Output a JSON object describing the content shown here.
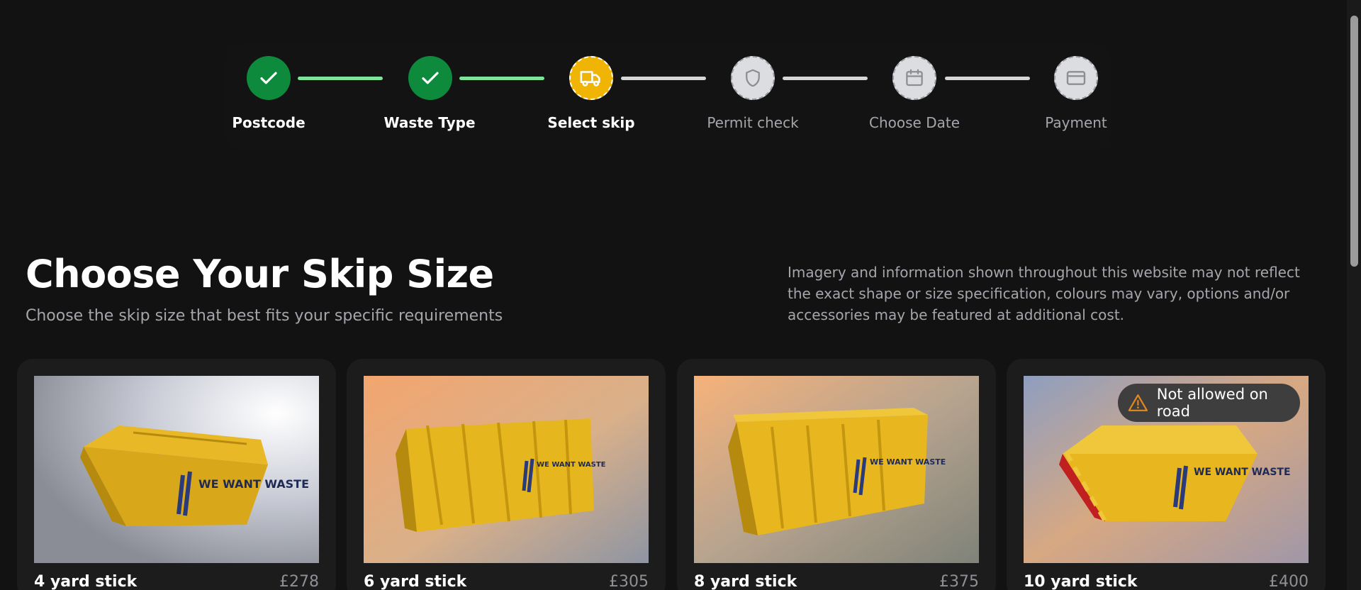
{
  "stepper": {
    "steps": [
      {
        "label": "Postcode",
        "status": "done",
        "icon": "check-icon"
      },
      {
        "label": "Waste Type",
        "status": "done",
        "icon": "check-icon"
      },
      {
        "label": "Select skip",
        "status": "current",
        "icon": "truck-icon"
      },
      {
        "label": "Permit check",
        "status": "pending",
        "icon": "shield-icon"
      },
      {
        "label": "Choose Date",
        "status": "pending",
        "icon": "calendar-icon"
      },
      {
        "label": "Payment",
        "status": "pending",
        "icon": "credit-card-icon"
      }
    ]
  },
  "header": {
    "title": "Choose Your Skip Size",
    "subtitle": "Choose the skip size that best fits your specific requirements",
    "disclaimer": "Imagery and information shown throughout this website may not reflect the exact shape or size specification, colours may vary, options and/or accessories may be featured at additional cost."
  },
  "cards": [
    {
      "name": "4 yard stick",
      "price": "£278",
      "image_logo": "WE WANT WASTE"
    },
    {
      "name": "6 yard stick",
      "price": "£305",
      "image_logo": "WE WANT WASTE"
    },
    {
      "name": "8 yard stick",
      "price": "£375",
      "image_logo": "WE WANT WASTE"
    },
    {
      "name": "10 yard stick",
      "price": "£400",
      "image_logo": "WE WANT WASTE",
      "badge": "Not allowed on road",
      "badge_icon": "warning-icon"
    }
  ],
  "colors": {
    "background": "#121212",
    "card": "#1c1c1c",
    "done": "#0e8a3c",
    "current": "#efb404",
    "progress_line": "#7fe39a",
    "warning": "#e48a1d"
  }
}
